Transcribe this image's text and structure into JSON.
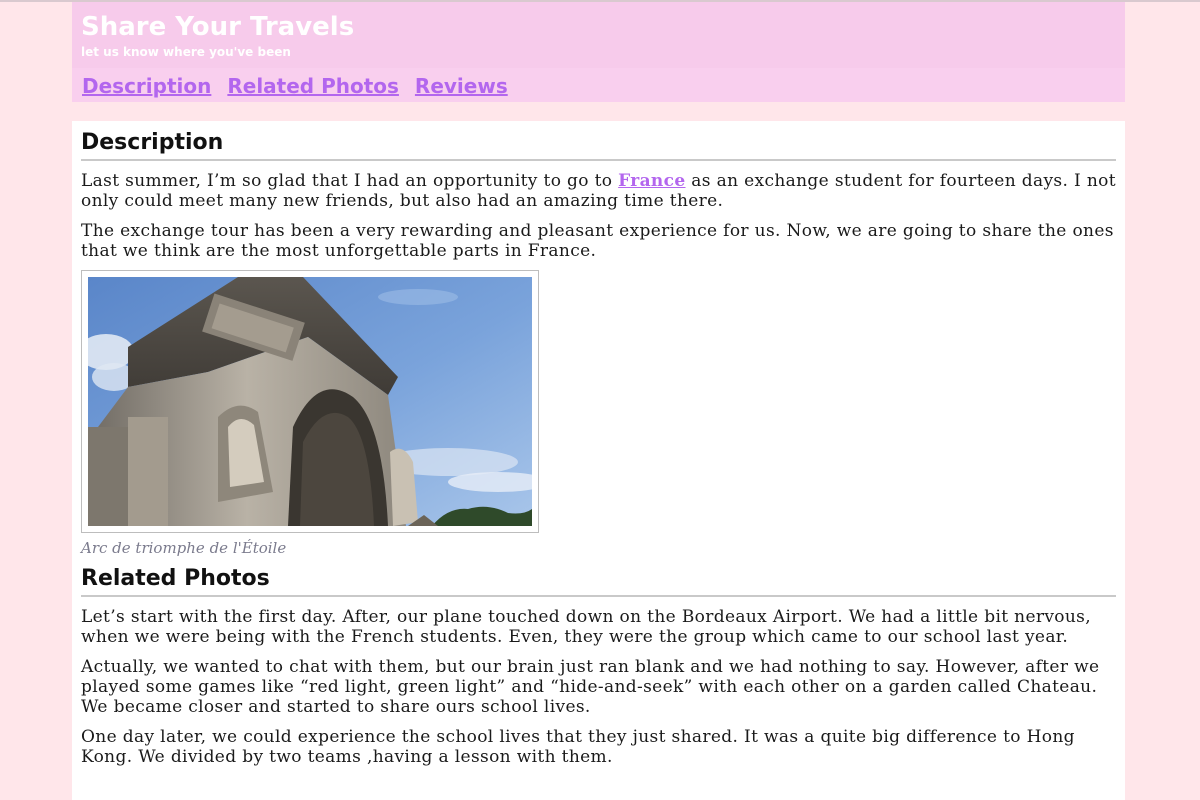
{
  "header": {
    "title": "Share Your Travels",
    "tagline": "let us know where you've been"
  },
  "nav": {
    "items": [
      {
        "label": "Description"
      },
      {
        "label": "Related Photos"
      },
      {
        "label": "Reviews"
      }
    ]
  },
  "description": {
    "heading": "Description",
    "p1_before": "Last summer, I’m so glad that I had an opportunity to go to ",
    "p1_link": "France",
    "p1_after": " as an exchange student for fourteen days. I not only could meet many new friends, but also had an amazing time there.",
    "p2": "The exchange tour has been a very rewarding and pleasant experience for us. Now, we are going to share the ones that we think are the most unforgettable parts in France.",
    "figure": {
      "image": "arc-de-triomphe-photo",
      "caption": "Arc de triomphe de l'Étoile"
    }
  },
  "related_photos": {
    "heading": "Related Photos",
    "p1": "Let’s start with the first day. After, our plane touched down on the Bordeaux Airport. We had a little bit nervous, when we were being with the French students. Even, they were the group which came to our school last year.",
    "p2": "Actually, we wanted to chat with them, but our brain just ran blank and we had nothing to say. However, after we played some games like “red light, green light” and “hide-and-seek” with each other on a garden called Chateau. We became closer and started to share ours school lives.",
    "p3": "One day later, we could experience the school lives that they just shared. It was a quite big difference to Hong Kong. We divided by two teams ,having a lesson with them."
  },
  "colors": {
    "page_background": "#ffe6ea",
    "header_background": "#f9cfee",
    "link": "#b366ee",
    "caption": "#7b7b8d"
  }
}
